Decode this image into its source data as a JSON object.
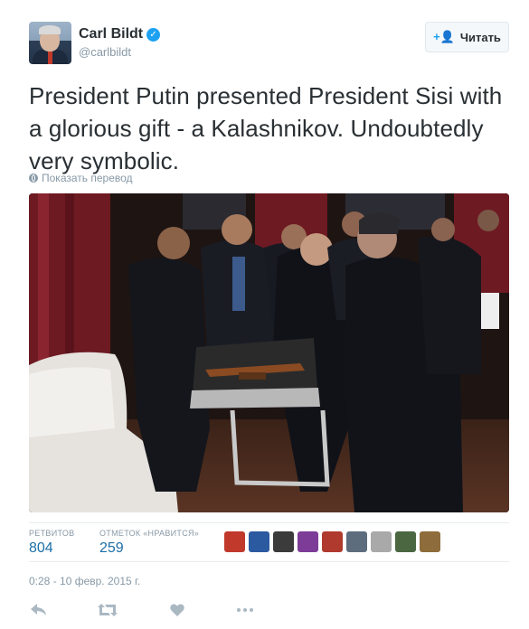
{
  "user": {
    "display_name": "Carl Bildt",
    "handle": "@carlbildt",
    "verified": true
  },
  "follow_button": {
    "label": "Читать",
    "icon": "follow-user-icon"
  },
  "tweet": {
    "text": "President Putin presented President Sisi with a glorious gift - a Kalashnikov. Undoubtedly very symbolic."
  },
  "translate": {
    "label": "Показать перевод",
    "icon": "globe-icon"
  },
  "stats": {
    "retweets_label": "РЕТВИТОВ",
    "retweets_value": "804",
    "likes_label": "ОТМЕТОК «НРАВИТСЯ»",
    "likes_value": "259",
    "liker_avatar_colors": [
      "#c0392b",
      "#2c5aa0",
      "#3b3b3b",
      "#7d3c98",
      "#b03a2e",
      "#5d6d7e",
      "#a9a9a9",
      "#4a6741",
      "#8e6c3b"
    ]
  },
  "timestamp": "0:28 - 10 февр. 2015 г.",
  "actions": [
    "reply-icon",
    "retweet-icon",
    "like-icon",
    "more-icon"
  ],
  "colors": {
    "accent": "#1da1f2",
    "stat_value": "#1d6fa5",
    "muted": "#8899a6"
  }
}
